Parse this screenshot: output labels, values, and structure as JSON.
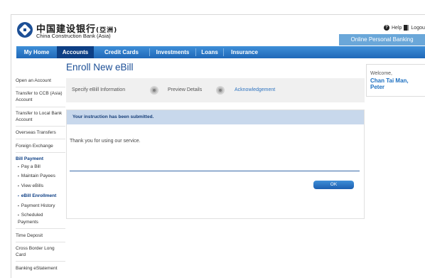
{
  "bank": {
    "name_cn": "中国建设银行",
    "name_suffix_cn": "(亞洲)",
    "name_en": "China Construction Bank (Asia)"
  },
  "top_links": {
    "help": "Help",
    "logout": "Logou"
  },
  "online_banking_tab": "Online Personal Banking",
  "nav": [
    {
      "label": "My Home"
    },
    {
      "label": "Accounts"
    },
    {
      "label": "Credit Cards"
    },
    {
      "label": "Investments"
    },
    {
      "label": "Loans"
    },
    {
      "label": "Insurance"
    }
  ],
  "sidebar": [
    "Open an Account",
    "Transfer to CCB (Asia) Account",
    "Transfer to Local Bank Account",
    "Overseas Transfers",
    "Foreign Exchange",
    "Bill Payment",
    "Pay a Bill",
    "Maintain Payees",
    "View eBills",
    "eBill Enrollment",
    "Payment History",
    "Scheduled Payments",
    "Time Deposit",
    "Cross Border Long Card",
    "Banking eStatement"
  ],
  "page_title": "Enroll New eBill",
  "steps": [
    "Specify eBill Information",
    "Preview Details",
    "Acknowledgement"
  ],
  "panel": {
    "header": "Your instruction has been submitted.",
    "message": "Thank you for using our service.",
    "ok_label": "OK"
  },
  "welcome": {
    "label": "Welcome,",
    "name": "Chan Tai Man, Peter"
  },
  "colors": {
    "nav_blue": "#1f68b8",
    "nav_active": "#0d3f85",
    "title_blue": "#1c4f96",
    "step_active": "#2f74c0",
    "panel_header": "#c8d8ec"
  }
}
